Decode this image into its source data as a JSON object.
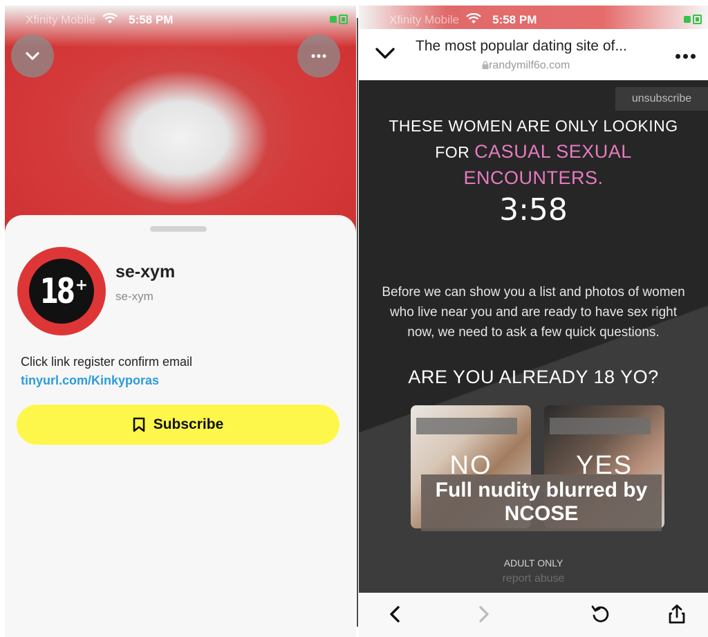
{
  "status_bar": {
    "carrier": "Xfinity Mobile",
    "time": "5:58 PM"
  },
  "left_panel": {
    "profile": {
      "avatar_text": "18",
      "avatar_plus": "+",
      "name": "se-xym",
      "handle": "se-xym"
    },
    "bio": "Click link register confirm email",
    "link": "tinyurl.com/Kinkyporas",
    "subscribe_label": "Subscribe"
  },
  "right_panel": {
    "browser": {
      "title": "The most popular dating site of...",
      "domain": "randymilf6o.com"
    },
    "page": {
      "unsubscribe": "unsubscribe",
      "headline_white_1": "THESE WOMEN ARE ONLY LOOKING",
      "headline_white_2": "FOR",
      "headline_pink_1": "CASUAL SEXUAL",
      "headline_pink_2": "ENCOUNTERS.",
      "timer": "3:58",
      "description": "Before we can show you a list and photos of women who live near you and are ready to have sex right now, we need to ask a few quick questions.",
      "question": "ARE YOU ALREADY 18 YO?",
      "choice_no": "NO",
      "choice_yes": "YES",
      "blur_note_1": "Full nudity blurred by",
      "blur_note_2": "NCOSE",
      "adult_only": "ADULT ONLY",
      "report_abuse": "report abuse"
    }
  },
  "colors": {
    "accent_pink": "#e77bc0",
    "subscribe_yellow": "#fef74b",
    "link_blue": "#2d9cdb",
    "badge_red": "#de3636"
  }
}
